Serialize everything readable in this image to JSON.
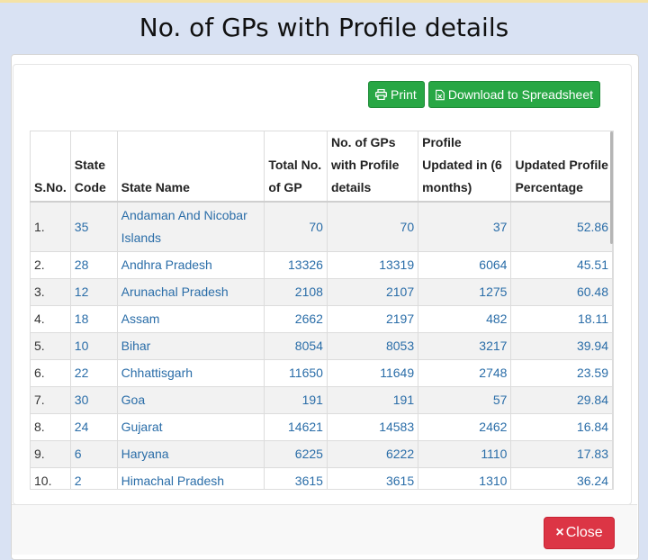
{
  "modal": {
    "title": "No. of GPs with Profile details",
    "print_label": "Print",
    "download_label": "Download to Spreadsheet",
    "close_label": "Close",
    "close_icon": "×"
  },
  "colors": {
    "button_green": "#28a745",
    "button_red": "#dc3545",
    "link_blue": "#2a6da8",
    "backdrop": "#d9e2f3"
  },
  "icons": {
    "print": "print-icon",
    "download": "file-excel-icon",
    "close": "close-icon"
  },
  "table": {
    "headers": [
      "S.No.",
      "State Code",
      "State Name",
      "Total No. of GP",
      "No. of GPs with Profile details",
      "Profile Updated in (6 months)",
      "Updated Profile Percentage"
    ],
    "rows": [
      {
        "sno": "1.",
        "code": "35",
        "name": "Andaman And Nicobar Islands",
        "total": "70",
        "with_profile": "70",
        "updated": "37",
        "pct": "52.86"
      },
      {
        "sno": "2.",
        "code": "28",
        "name": "Andhra Pradesh",
        "total": "13326",
        "with_profile": "13319",
        "updated": "6064",
        "pct": "45.51"
      },
      {
        "sno": "3.",
        "code": "12",
        "name": "Arunachal Pradesh",
        "total": "2108",
        "with_profile": "2107",
        "updated": "1275",
        "pct": "60.48"
      },
      {
        "sno": "4.",
        "code": "18",
        "name": "Assam",
        "total": "2662",
        "with_profile": "2197",
        "updated": "482",
        "pct": "18.11"
      },
      {
        "sno": "5.",
        "code": "10",
        "name": "Bihar",
        "total": "8054",
        "with_profile": "8053",
        "updated": "3217",
        "pct": "39.94"
      },
      {
        "sno": "6.",
        "code": "22",
        "name": "Chhattisgarh",
        "total": "11650",
        "with_profile": "11649",
        "updated": "2748",
        "pct": "23.59"
      },
      {
        "sno": "7.",
        "code": "30",
        "name": "Goa",
        "total": "191",
        "with_profile": "191",
        "updated": "57",
        "pct": "29.84"
      },
      {
        "sno": "8.",
        "code": "24",
        "name": "Gujarat",
        "total": "14621",
        "with_profile": "14583",
        "updated": "2462",
        "pct": "16.84"
      },
      {
        "sno": "9.",
        "code": "6",
        "name": "Haryana",
        "total": "6225",
        "with_profile": "6222",
        "updated": "1110",
        "pct": "17.83"
      },
      {
        "sno": "10.",
        "code": "2",
        "name": "Himachal Pradesh",
        "total": "3615",
        "with_profile": "3615",
        "updated": "1310",
        "pct": "36.24"
      }
    ]
  }
}
